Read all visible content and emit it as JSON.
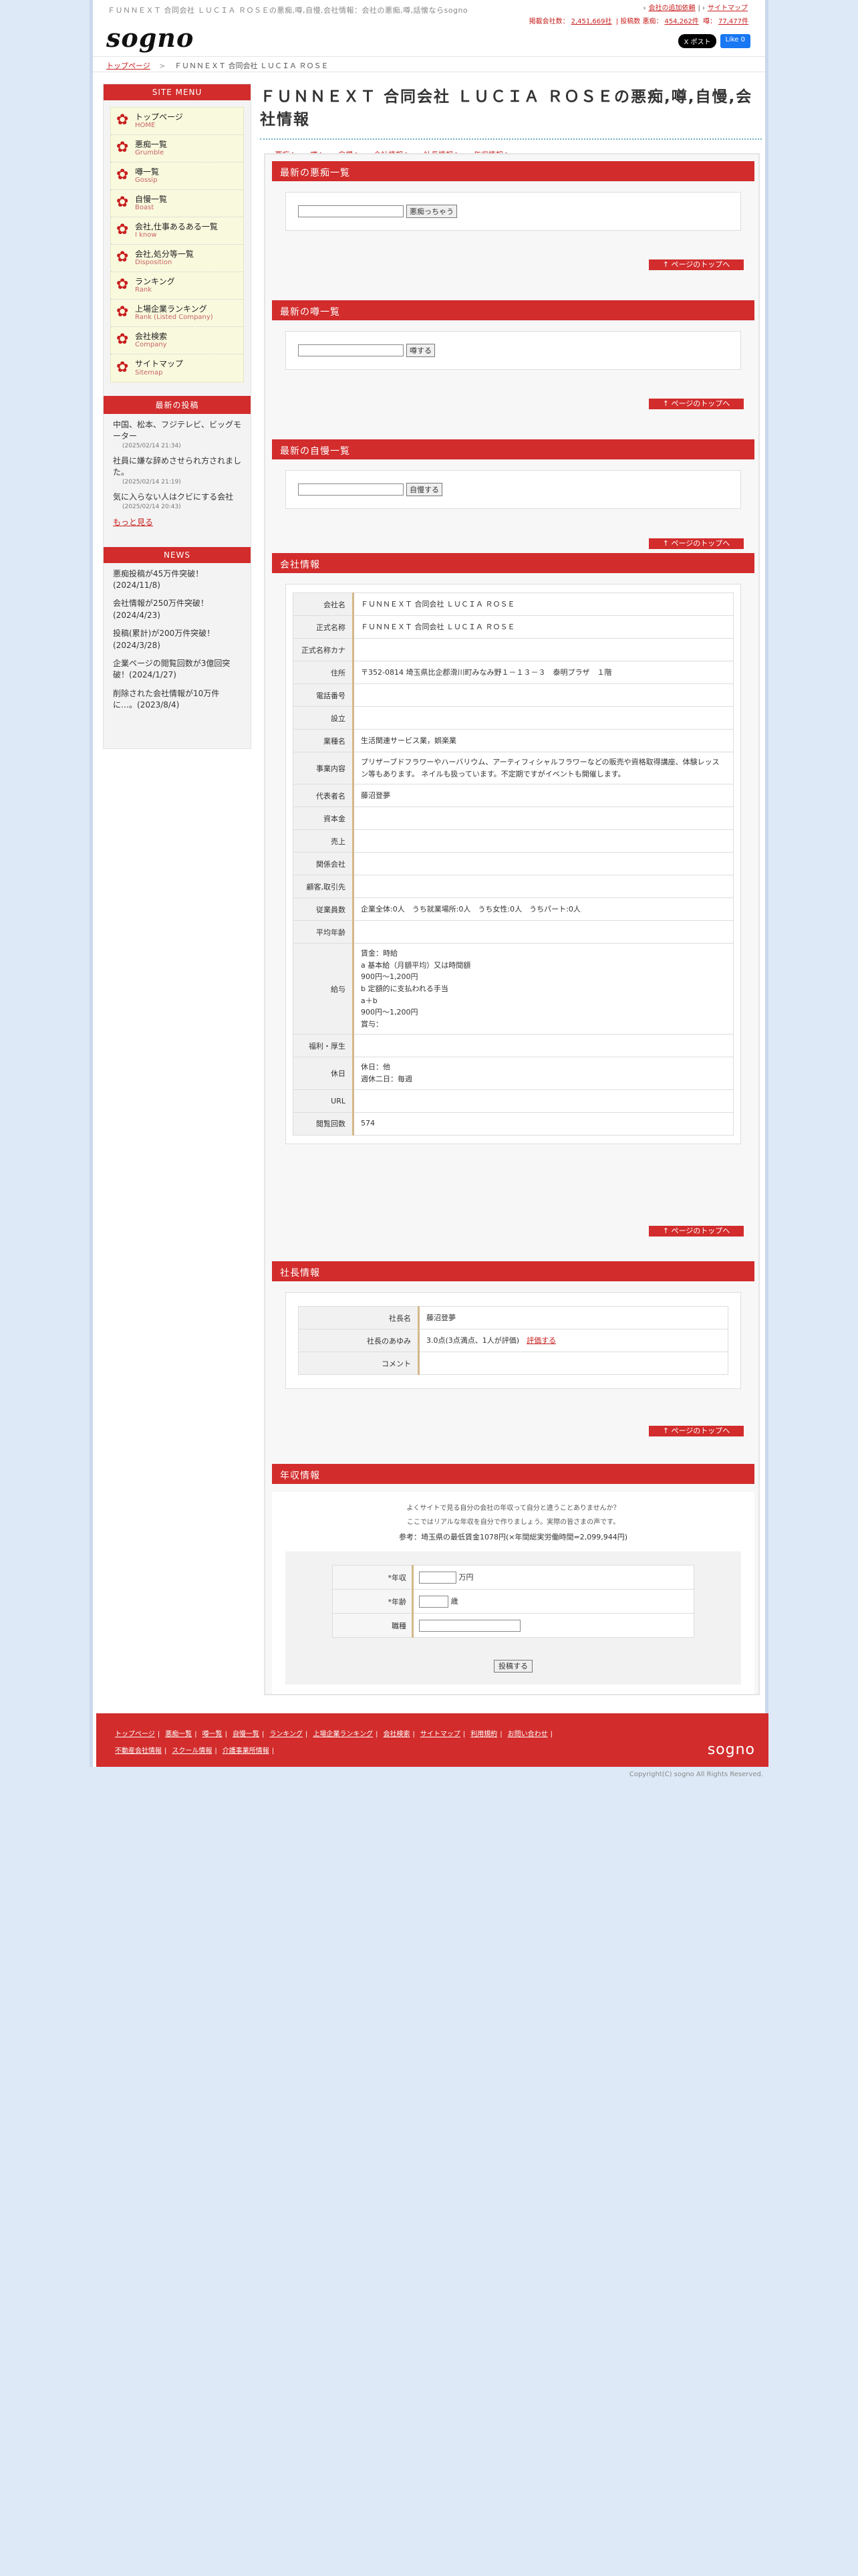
{
  "header": {
    "tagline": "ＦＵＮＮＥＸＴ 合同会社 ＬＵＣＩＡ ＲＯＳＥの悪痴,噂,自慢,会社情報：会社の悪痴,噂,話懐ならsogno",
    "logo": "sogno",
    "top_links": [
      "会社の追加依頼",
      "サイトマップ"
    ],
    "counts_label_company": "掲載会社数：",
    "counts_company": "2,451,669社",
    "counts_label_posts": "投稿数 悪痴：",
    "counts_complaints": "454,262件",
    "counts_label_rumor": "噂：",
    "counts_rumors": "77,477件",
    "x_button": "X ポスト",
    "fb_button": "Like 0"
  },
  "breadcrumb": {
    "home": "トップページ",
    "sep": ">",
    "current": "ＦＵＮＮＥＸＴ 合同会社 ＬＵＣＩＡ ＲＯＳＥ"
  },
  "sidebar": {
    "menu_title": "SITE MENU",
    "items": [
      {
        "label": "トップページ",
        "sub": "HOME"
      },
      {
        "label": "悪痴一覧",
        "sub": "Grumble"
      },
      {
        "label": "噂一覧",
        "sub": "Gossip"
      },
      {
        "label": "自慢一覧",
        "sub": "Boast"
      },
      {
        "label": "会社,仕事あるある一覧",
        "sub": "I know"
      },
      {
        "label": "会社,処分等一覧",
        "sub": "Disposition"
      },
      {
        "label": "ランキング",
        "sub": "Rank"
      },
      {
        "label": "上場企業ランキング",
        "sub": "Rank (Listed Company)"
      },
      {
        "label": "会社検索",
        "sub": "Company"
      },
      {
        "label": "サイトマップ",
        "sub": "Sitemap"
      }
    ],
    "posts_title": "最新の投稿",
    "posts": [
      {
        "text": "中国、松本、フジテレビ、ビッグモーター",
        "date": "(2025/02/14 21:34)"
      },
      {
        "text": "社員に嫌な辞めさせられ方されました。",
        "date": "(2025/02/14 21:19)"
      },
      {
        "text": "気に入らない人はクビにする会社",
        "date": "(2025/02/14 20:43)"
      }
    ],
    "more_link": "もっと見る",
    "news_title": "NEWS",
    "news": [
      "悪痴投稿が45万件突破！(2024/11/8)",
      "会社情報が250万件突破！(2024/4/23)",
      "投稿(累計)が200万件突破！(2024/3/28)",
      "企業ページの閲覧回数が3億回突破！(2024/1/27)",
      "削除された会社情報が10万件に…。(2023/8/4)"
    ]
  },
  "main": {
    "title": "ＦＵＮＮＥＸＴ 合同会社 ＬＵＣＩＡ ＲＯＳＥの悪痴,噂,自慢,会社情報",
    "subnav": [
      "悪痴へ",
      "噂へ",
      "自慢へ",
      "会社情報へ",
      "社長情報へ",
      "年収情報へ"
    ],
    "to_top": "ページのトップへ",
    "complaints": {
      "title": "最新の悪痴一覧",
      "button": "悪痴っちゃう"
    },
    "rumors": {
      "title": "最新の噂一覧",
      "button": "噂する"
    },
    "boasts": {
      "title": "最新の自慢一覧",
      "button": "自慢する"
    },
    "company": {
      "title": "会社情報",
      "rows": [
        {
          "label": "会社名",
          "value": "ＦＵＮＮＥＸＴ 合同会社 ＬＵＣＩＡ ＲＯＳＥ"
        },
        {
          "label": "正式名称",
          "value": "ＦＵＮＮＥＸＴ 合同会社 ＬＵＣＩＡ ＲＯＳＥ"
        },
        {
          "label": "正式名称カナ",
          "value": ""
        },
        {
          "label": "住所",
          "value": "〒352-0814 埼玉県比企郡滑川町みなみ野１－１３－３　泰明プラザ　１階"
        },
        {
          "label": "電話番号",
          "value": ""
        },
        {
          "label": "設立",
          "value": ""
        },
        {
          "label": "業種名",
          "value": "生活関連サービス業，娯楽業"
        },
        {
          "label": "事業内容",
          "value": "プリザーブドフラワーやハーバリウム、アーティフィシャルフラワーなどの販売や資格取得講座、体験レッスン等もあります。 ネイルも扱っています。不定期ですがイベントも開催します。"
        },
        {
          "label": "代表者名",
          "value": "藤沼登夢"
        },
        {
          "label": "資本金",
          "value": ""
        },
        {
          "label": "売上",
          "value": ""
        },
        {
          "label": "関係会社",
          "value": ""
        },
        {
          "label": "顧客,取引先",
          "value": ""
        },
        {
          "label": "従業員数",
          "value": "企業全体:0人　うち就業場所:0人　うち女性:0人　うちパート:0人"
        },
        {
          "label": "平均年齢",
          "value": ""
        },
        {
          "label": "給与",
          "value": "賃金：時給\na 基本給（月額平均）又は時間額\n900円〜1,200円\nb 定額的に支払われる手当\na＋b\n900円〜1,200円\n賞与："
        },
        {
          "label": "福利・厚生",
          "value": ""
        },
        {
          "label": "休日",
          "value": "休日：他\n週休二日：毎週"
        },
        {
          "label": "URL",
          "value": ""
        },
        {
          "label": "閲覧回数",
          "value": "574"
        }
      ]
    },
    "president": {
      "title": "社長情報",
      "name_label": "社長名",
      "name": "藤沼登夢",
      "eval_label": "社長のあゆみ",
      "eval": "3.0点(3点満点、1人が評価)",
      "eval_link": "評価する",
      "comment_label": "コメント",
      "comment": ""
    },
    "salary": {
      "title": "年収情報",
      "note1": "よくサイトで見る自分の会社の年収って自分と違うことありませんか？",
      "note2": "ここではリアルな年収を自分で作りましょう。実際の皆さまの声です。",
      "reference": "参考：埼玉県の最低賃金1078円(×年間総実労働時間=2,099,944円)",
      "fields": [
        {
          "label": "*年収",
          "unit": "万円"
        },
        {
          "label": "*年齢",
          "unit": "歳"
        },
        {
          "label": "職種",
          "unit": ""
        }
      ],
      "button": "投稿する"
    }
  },
  "footer": {
    "row1": [
      "トップページ",
      "悪痴一覧",
      "噂一覧",
      "自慢一覧",
      "ランキング",
      "上場企業ランキング",
      "会社検索",
      "サイトマップ",
      "利用規約",
      "お問い合わせ"
    ],
    "row2": [
      "不動産会社情報",
      "スクール情報",
      "介護事業所情報"
    ],
    "logo": "sogno",
    "copyright": "Copyright(C) sogno All Rights Reserved."
  }
}
